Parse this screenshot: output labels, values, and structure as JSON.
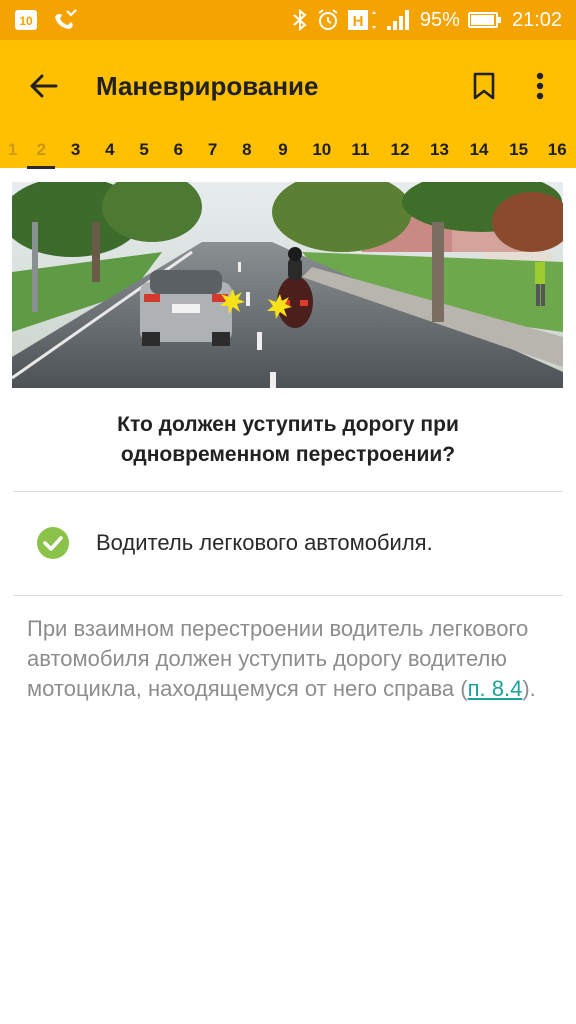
{
  "status_bar": {
    "battery_level": 0.95,
    "battery_percent": "95%",
    "time": "21:02",
    "h_label": "H"
  },
  "app_bar": {
    "title": "Маневрирование"
  },
  "tabs": [
    "1",
    "2",
    "3",
    "4",
    "5",
    "6",
    "7",
    "8",
    "9",
    "10",
    "11",
    "12",
    "13",
    "14",
    "15",
    "16"
  ],
  "active_tab": "2",
  "question": {
    "text": "Кто должен уступить дорогу при одновременном перестроении?"
  },
  "answer": {
    "text": "Водитель легкового автомобиля.",
    "correct": true
  },
  "explanation": {
    "text_before": "При взаимном перестроении водитель легкового автомобиля должен уступить дорогу водителю мотоцикла, находящемуся от него справа (",
    "link_text": "п. 8.4",
    "text_after": ")."
  },
  "colors": {
    "status_bar": "#f5a300",
    "app_bar": "#fec000",
    "check": "#8bc34a",
    "link": "#18a397"
  }
}
